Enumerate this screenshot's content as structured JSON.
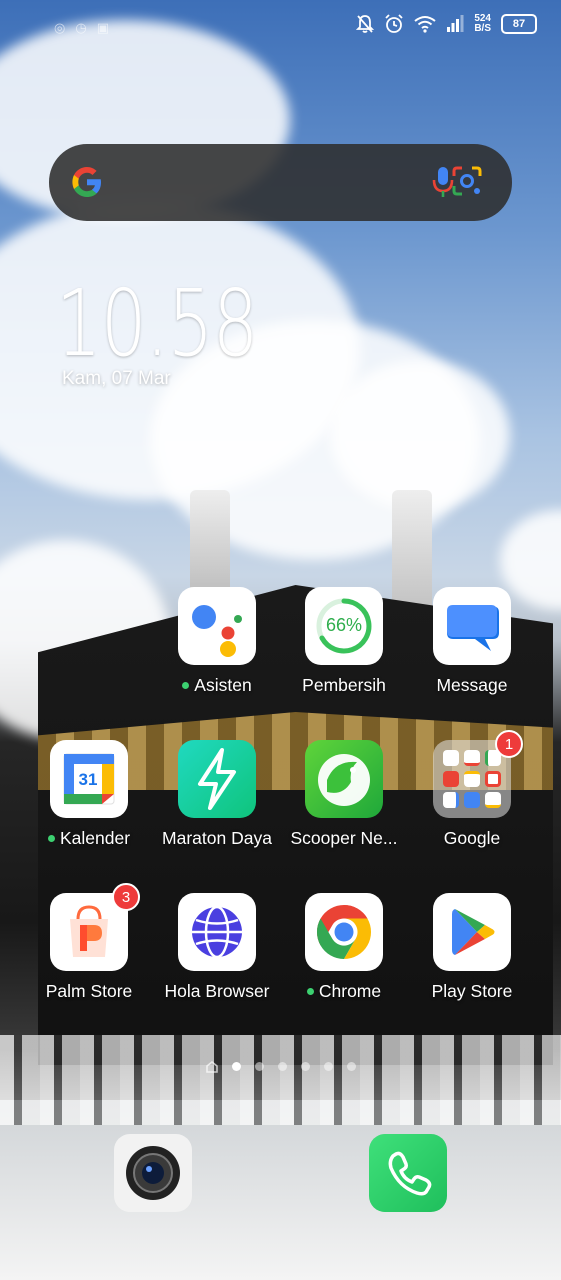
{
  "status_bar": {
    "net_speed_value": "524",
    "net_speed_unit": "B/S",
    "battery": "87"
  },
  "clock": {
    "time": "10.58",
    "date": "Kam, 07 Mar"
  },
  "apps": [
    {
      "label": "Asisten",
      "dot": true
    },
    {
      "label": "Pembersih",
      "badge_text": "66%"
    },
    {
      "label": "Message"
    },
    {
      "label": "Kalender",
      "dot": true,
      "icon_text": "31"
    },
    {
      "label": "Maraton Daya"
    },
    {
      "label": "Scooper Ne..."
    },
    {
      "label": "Google",
      "badge": "1"
    },
    {
      "label": "Palm Store",
      "badge": "3"
    },
    {
      "label": "Hola Browser"
    },
    {
      "label": "Chrome",
      "dot": true
    },
    {
      "label": "Play Store"
    }
  ],
  "page_indicator": {
    "count": 6,
    "active_index": 0
  }
}
